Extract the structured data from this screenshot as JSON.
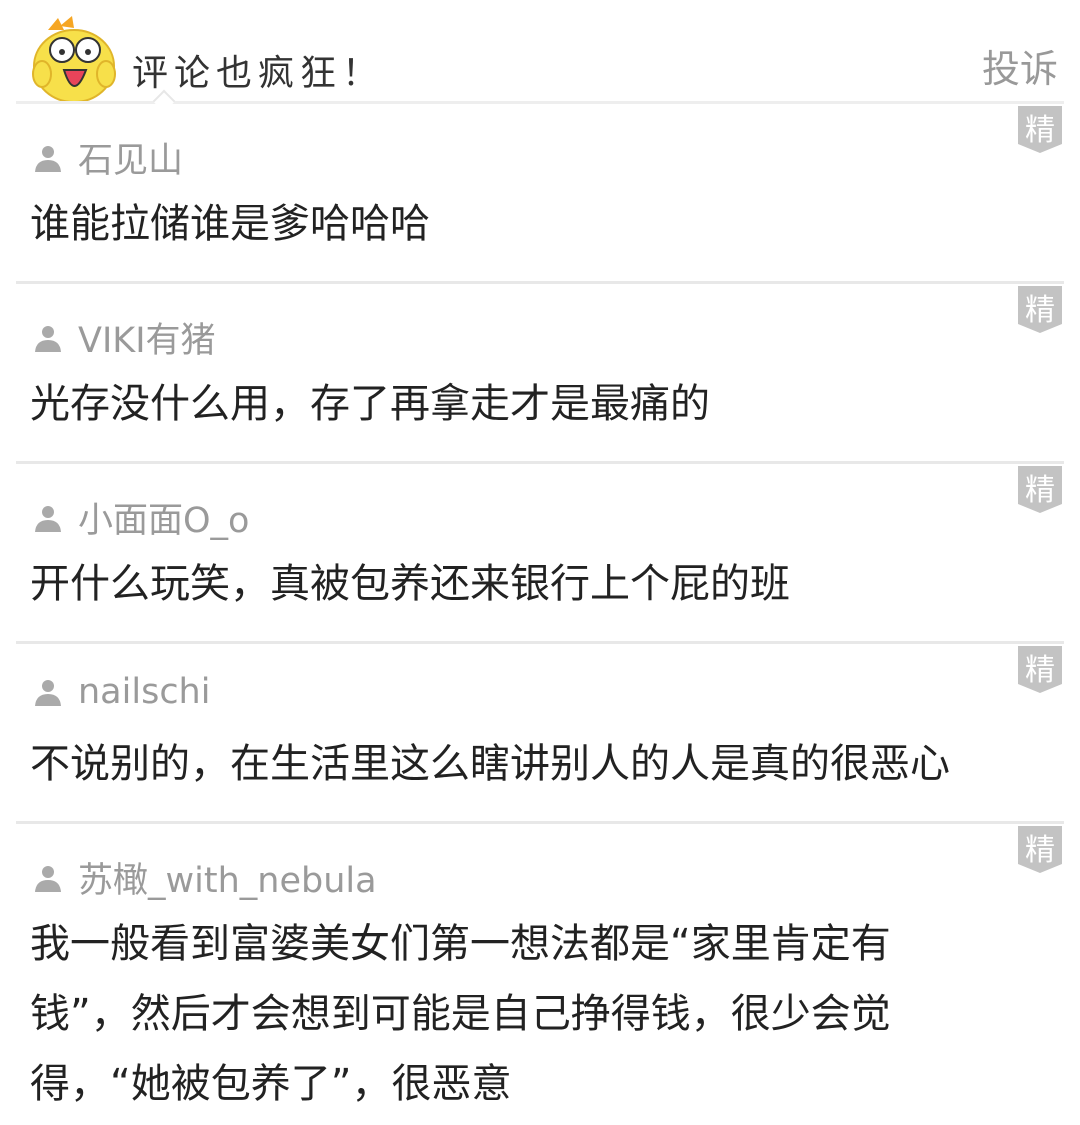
{
  "header": {
    "title": "评论也疯狂！",
    "report_label": "投诉"
  },
  "badge_label": "精",
  "comments": [
    {
      "user": "石见山",
      "text": "谁能拉储谁是爹哈哈哈"
    },
    {
      "user": "VIKI有猪",
      "text": "光存没什么用，存了再拿走才是最痛的"
    },
    {
      "user": "小面面O_o",
      "text": "开什么玩笑，真被包养还来银行上个屁的班"
    },
    {
      "user": "nailschi",
      "text": "不说别的，在生活里这么瞎讲别人的人是真的很恶心"
    },
    {
      "user": "苏橄_with_nebula",
      "text": "我一般看到富婆美女们第一想法都是“家里肯定有钱”，然后才会想到可能是自己挣得钱，很少会觉得，“她被包养了”，很恶意"
    }
  ],
  "colors": {
    "badge": "#c3c3c3",
    "mascot": "#f7e04a",
    "report": "#999999"
  }
}
